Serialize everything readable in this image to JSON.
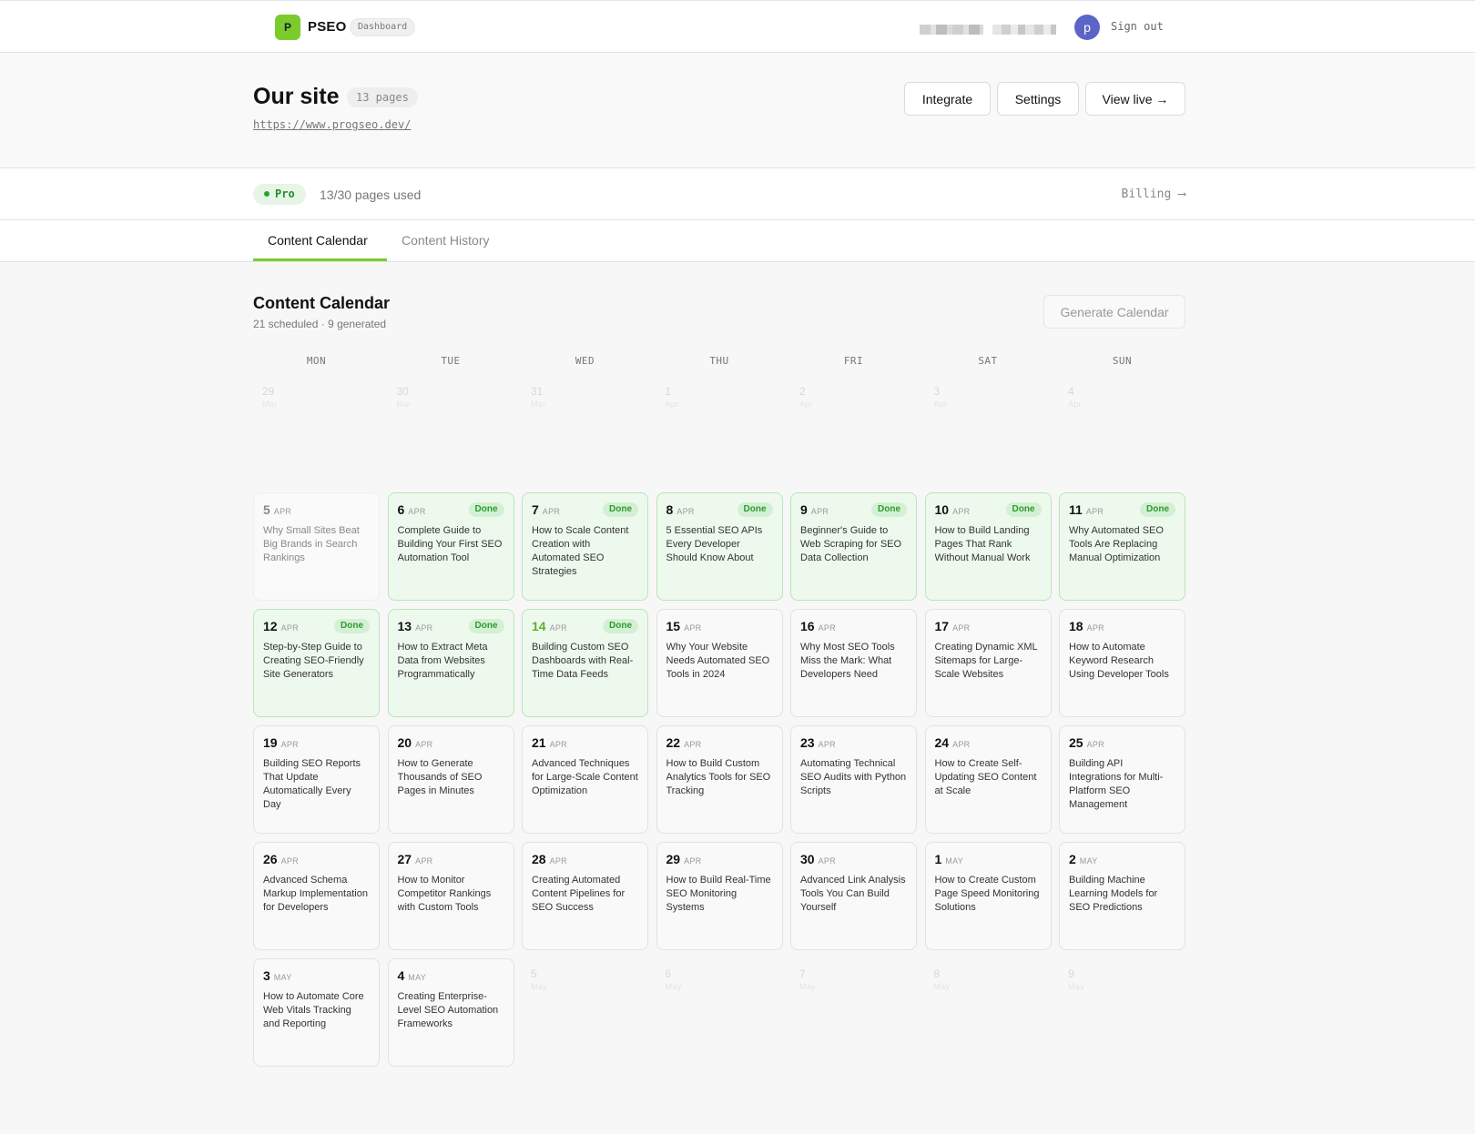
{
  "nav": {
    "logo_letter": "P",
    "brand": "PSEO",
    "dashboard_badge": "Dashboard",
    "avatar_letter": "p",
    "sign_out": "Sign out"
  },
  "site": {
    "title": "Our site",
    "pages_badge": "13 pages",
    "url": "https://www.progseo.dev/",
    "buttons": {
      "integrate": "Integrate",
      "settings": "Settings",
      "view_live": "View live →"
    }
  },
  "plan": {
    "badge": "Pro",
    "pages_used": "13/30 pages used",
    "billing": "Billing ⟶"
  },
  "tabs": {
    "calendar": "Content Calendar",
    "history": "Content History"
  },
  "calendar": {
    "title": "Content Calendar",
    "subtitle": "21 scheduled · 9 generated",
    "generate_button": "Generate Calendar",
    "weekdays": [
      "MON",
      "TUE",
      "WED",
      "THU",
      "FRI",
      "SAT",
      "SUN"
    ],
    "weeks": [
      [
        {
          "day": "29",
          "month": "Mar",
          "status": "empty",
          "title": ""
        },
        {
          "day": "30",
          "month": "Mar",
          "status": "empty",
          "title": ""
        },
        {
          "day": "31",
          "month": "Mar",
          "status": "empty",
          "title": ""
        },
        {
          "day": "1",
          "month": "Apr",
          "status": "empty",
          "title": ""
        },
        {
          "day": "2",
          "month": "Apr",
          "status": "empty",
          "title": ""
        },
        {
          "day": "3",
          "month": "Apr",
          "status": "empty",
          "title": ""
        },
        {
          "day": "4",
          "month": "Apr",
          "status": "empty",
          "title": ""
        }
      ],
      [
        {
          "day": "5",
          "month": "APR",
          "status": "past",
          "title": "Why Small Sites Beat Big Brands in Search Rankings"
        },
        {
          "day": "6",
          "month": "APR",
          "status": "done",
          "title": "Complete Guide to Building Your First SEO Automation Tool"
        },
        {
          "day": "7",
          "month": "APR",
          "status": "done",
          "title": "How to Scale Content Creation with Automated SEO Strategies"
        },
        {
          "day": "8",
          "month": "APR",
          "status": "done",
          "title": "5 Essential SEO APIs Every Developer Should Know About"
        },
        {
          "day": "9",
          "month": "APR",
          "status": "done",
          "title": "Beginner's Guide to Web Scraping for SEO Data Collection"
        },
        {
          "day": "10",
          "month": "APR",
          "status": "done",
          "title": "How to Build Landing Pages That Rank Without Manual Work"
        },
        {
          "day": "11",
          "month": "APR",
          "status": "done",
          "title": "Why Automated SEO Tools Are Replacing Manual Optimization"
        }
      ],
      [
        {
          "day": "12",
          "month": "APR",
          "status": "done",
          "title": "Step-by-Step Guide to Creating SEO-Friendly Site Generators"
        },
        {
          "day": "13",
          "month": "APR",
          "status": "done",
          "title": "How to Extract Meta Data from Websites Programmatically"
        },
        {
          "day": "14",
          "month": "APR",
          "status": "done-today",
          "title": "Building Custom SEO Dashboards with Real-Time Data Feeds"
        },
        {
          "day": "15",
          "month": "APR",
          "status": "scheduled",
          "title": "Why Your Website Needs Automated SEO Tools in 2024"
        },
        {
          "day": "16",
          "month": "APR",
          "status": "scheduled",
          "title": "Why Most SEO Tools Miss the Mark: What Developers Need"
        },
        {
          "day": "17",
          "month": "APR",
          "status": "scheduled",
          "title": "Creating Dynamic XML Sitemaps for Large-Scale Websites"
        },
        {
          "day": "18",
          "month": "APR",
          "status": "scheduled",
          "title": "How to Automate Keyword Research Using Developer Tools"
        }
      ],
      [
        {
          "day": "19",
          "month": "APR",
          "status": "scheduled",
          "title": "Building SEO Reports That Update Automatically Every Day"
        },
        {
          "day": "20",
          "month": "APR",
          "status": "scheduled",
          "title": "How to Generate Thousands of SEO Pages in Minutes"
        },
        {
          "day": "21",
          "month": "APR",
          "status": "scheduled",
          "title": "Advanced Techniques for Large-Scale Content Optimization"
        },
        {
          "day": "22",
          "month": "APR",
          "status": "scheduled",
          "title": "How to Build Custom Analytics Tools for SEO Tracking"
        },
        {
          "day": "23",
          "month": "APR",
          "status": "scheduled",
          "title": "Automating Technical SEO Audits with Python Scripts"
        },
        {
          "day": "24",
          "month": "APR",
          "status": "scheduled",
          "title": "How to Create Self-Updating SEO Content at Scale"
        },
        {
          "day": "25",
          "month": "APR",
          "status": "scheduled",
          "title": "Building API Integrations for Multi-Platform SEO Management"
        }
      ],
      [
        {
          "day": "26",
          "month": "APR",
          "status": "scheduled",
          "title": "Advanced Schema Markup Implementation for Developers"
        },
        {
          "day": "27",
          "month": "APR",
          "status": "scheduled",
          "title": "How to Monitor Competitor Rankings with Custom Tools"
        },
        {
          "day": "28",
          "month": "APR",
          "status": "scheduled",
          "title": "Creating Automated Content Pipelines for SEO Success"
        },
        {
          "day": "29",
          "month": "APR",
          "status": "scheduled",
          "title": "How to Build Real-Time SEO Monitoring Systems"
        },
        {
          "day": "30",
          "month": "APR",
          "status": "scheduled",
          "title": "Advanced Link Analysis Tools You Can Build Yourself"
        },
        {
          "day": "1",
          "month": "MAY",
          "status": "scheduled",
          "title": "How to Create Custom Page Speed Monitoring Solutions"
        },
        {
          "day": "2",
          "month": "MAY",
          "status": "scheduled",
          "title": "Building Machine Learning Models for SEO Predictions"
        }
      ],
      [
        {
          "day": "3",
          "month": "MAY",
          "status": "scheduled",
          "title": "How to Automate Core Web Vitals Tracking and Reporting"
        },
        {
          "day": "4",
          "month": "MAY",
          "status": "scheduled",
          "title": "Creating Enterprise-Level SEO Automation Frameworks"
        },
        {
          "day": "5",
          "month": "May",
          "status": "empty",
          "title": ""
        },
        {
          "day": "6",
          "month": "May",
          "status": "empty",
          "title": ""
        },
        {
          "day": "7",
          "month": "May",
          "status": "empty",
          "title": ""
        },
        {
          "day": "8",
          "month": "May",
          "status": "empty",
          "title": ""
        },
        {
          "day": "9",
          "month": "May",
          "status": "empty",
          "title": ""
        }
      ]
    ],
    "done_label": "Done"
  }
}
